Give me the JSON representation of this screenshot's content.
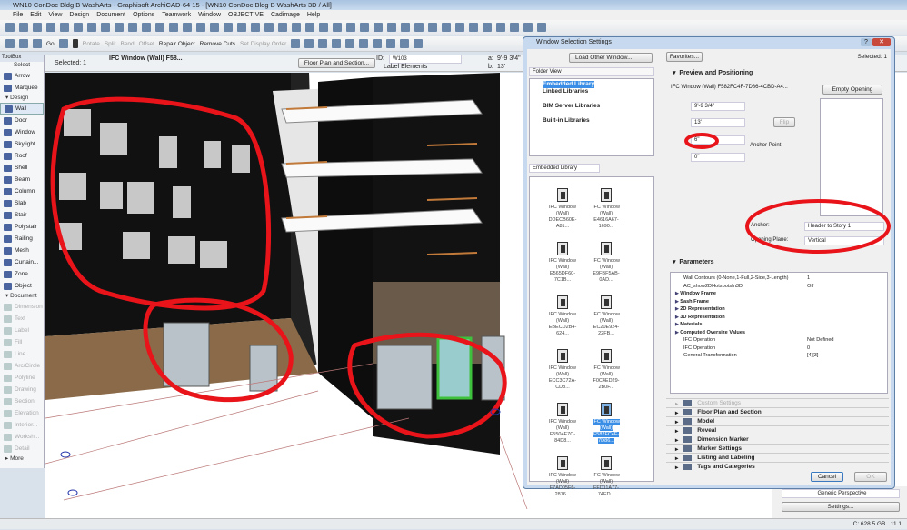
{
  "window": {
    "title": "WN10 ConDoc Bldg B WashArts - Graphisoft ArchiCAD-64 15 - [WN10 ConDoc Bldg B WashArts 3D / All]"
  },
  "menu": [
    "File",
    "Edit",
    "View",
    "Design",
    "Document",
    "Options",
    "Teamwork",
    "Window",
    "OBJECTIVE",
    "Cadimage",
    "Help"
  ],
  "toolbar2": {
    "go": "Go",
    "items": [
      {
        "label": "Rotate",
        "enabled": false
      },
      {
        "label": "Split",
        "enabled": false
      },
      {
        "label": "Bend",
        "enabled": false
      },
      {
        "label": "Offset",
        "enabled": false
      },
      {
        "label": "Repair Object",
        "enabled": true
      },
      {
        "label": "Remove Cuts",
        "enabled": true
      },
      {
        "label": "Set Display Order",
        "enabled": false
      }
    ]
  },
  "infobox": {
    "selected": "Selected: 1",
    "element": "IFC Window (Wall) F58...",
    "floor_plan_btn": "Floor Plan and Section...",
    "id_label": "ID:",
    "id_value": "W103",
    "label_elements": "Label Elements",
    "a_label": "a:",
    "a_value": "9'-9 3/4\"",
    "b_label": "b:",
    "b_value": "13'"
  },
  "toolbox": {
    "title": "ToolBox",
    "select": "Select",
    "design_header": "Design",
    "design": [
      "Arrow",
      "Marquee"
    ],
    "design_tools": [
      "Wall",
      "Door",
      "Window",
      "Skylight",
      "Roof",
      "Shell",
      "Beam",
      "Column",
      "Slab",
      "Stair",
      "Polystair",
      "Railing",
      "Mesh",
      "Curtain...",
      "Zone",
      "Object"
    ],
    "document_header": "Document",
    "document_tools": [
      "Dimension",
      "Text",
      "Label",
      "Fill",
      "Line",
      "Arc/Circle",
      "Polyline",
      "Drawing",
      "Section",
      "Elevation",
      "Interior...",
      "Worksh...",
      "Detail"
    ],
    "more": "More"
  },
  "dialog": {
    "title": "Window Selection Settings",
    "load_other": "Load Other Window...",
    "folder_view": "Folder View",
    "tree": [
      "Embedded Library",
      "Linked Libraries",
      "BIM Server Libraries",
      "Built-in Libraries"
    ],
    "library_select": "Embedded Library",
    "library_items": [
      {
        "l1": "IFC Window (Wall)",
        "l2": "DDECB60E-A81..."
      },
      {
        "l1": "IFC Window (Wall)",
        "l2": "E4616A67-1690..."
      },
      {
        "l1": "IFC Window (Wall)",
        "l2": "E565DF60-7C1B..."
      },
      {
        "l1": "IFC Window (Wall)",
        "l2": "E9FBF5AB-0AD..."
      },
      {
        "l1": "IFC Window (Wall)",
        "l2": "EBECD2B4-624..."
      },
      {
        "l1": "IFC Window (Wall)",
        "l2": "EC20E924-22FB..."
      },
      {
        "l1": "IFC Window (Wall)",
        "l2": "ECC3C72A-CD8..."
      },
      {
        "l1": "IFC Window (Wall)",
        "l2": "F0C4ED29-2B0F..."
      },
      {
        "l1": "IFC Window (Wall)",
        "l2": "F5504E7C-84D8..."
      },
      {
        "l1": "IFC Window (Wall)",
        "l2": "F582FC4F-7D86...",
        "selected": true
      },
      {
        "l1": "IFC Window (Wall)",
        "l2": "F7AD05F6-2876..."
      },
      {
        "l1": "IFC Window (Wall)",
        "l2": "FFD11A77-74ED..."
      }
    ],
    "favorites": "Favorites...",
    "selected": "Selected: 1",
    "preview_title": "Preview and Positioning",
    "object_name": "IFC Window (Wall) F582FC4F-7D86-4CBD-A4...",
    "empty_opening": "Empty Opening",
    "width": "9'-9 3/4\"",
    "height": "13'",
    "sill": "6\"",
    "offset": "0\"",
    "flip": "Flip",
    "anchor_point": "Anchor Point:",
    "anchor_label": "Anchor:",
    "anchor_value": "Header to Story 1",
    "plane_label": "Opening Plane:",
    "plane_value": "Vertical",
    "parameters_title": "Parameters",
    "parameters": [
      {
        "name": "Wall Contours (0-None,1-Full,2-Side,3-Length)",
        "value": "1",
        "group": false
      },
      {
        "name": "AC_show2DHotspotsIn3D",
        "value": "Off",
        "group": false
      },
      {
        "name": "Window Frame",
        "value": "",
        "group": true
      },
      {
        "name": "Sash Frame",
        "value": "",
        "group": true
      },
      {
        "name": "2D Representation",
        "value": "",
        "group": true
      },
      {
        "name": "3D Representation",
        "value": "",
        "group": true
      },
      {
        "name": "Materials",
        "value": "",
        "group": true
      },
      {
        "name": "Computed Oversize Values",
        "value": "",
        "group": true
      },
      {
        "name": "IFC Operation",
        "value": "Not Defined",
        "group": false
      },
      {
        "name": "IFC Operation",
        "value": "0",
        "group": false,
        "expandable": true
      },
      {
        "name": "General Transformation",
        "value": "[4][3]",
        "group": false
      }
    ],
    "sections": [
      {
        "label": "Custom Settings",
        "enabled": false
      },
      {
        "label": "Floor Plan and Section",
        "enabled": true
      },
      {
        "label": "Model",
        "enabled": true
      },
      {
        "label": "Reveal",
        "enabled": true
      },
      {
        "label": "Dimension Marker",
        "enabled": true
      },
      {
        "label": "Marker Settings",
        "enabled": true
      },
      {
        "label": "Listing and Labeling",
        "enabled": true
      },
      {
        "label": "Tags and Categories",
        "enabled": true
      }
    ],
    "cancel": "Cancel",
    "ok": "OK"
  },
  "navigator": {
    "view": "Generic Perspective",
    "settings": "Settings..."
  },
  "status": {
    "disk": "C: 628.5 GB",
    "mem": "11.1"
  },
  "colors": {
    "annotation_red": "#e8141a",
    "selection_green": "#3ec23e",
    "dialog_frame": "#c7d9ef"
  }
}
